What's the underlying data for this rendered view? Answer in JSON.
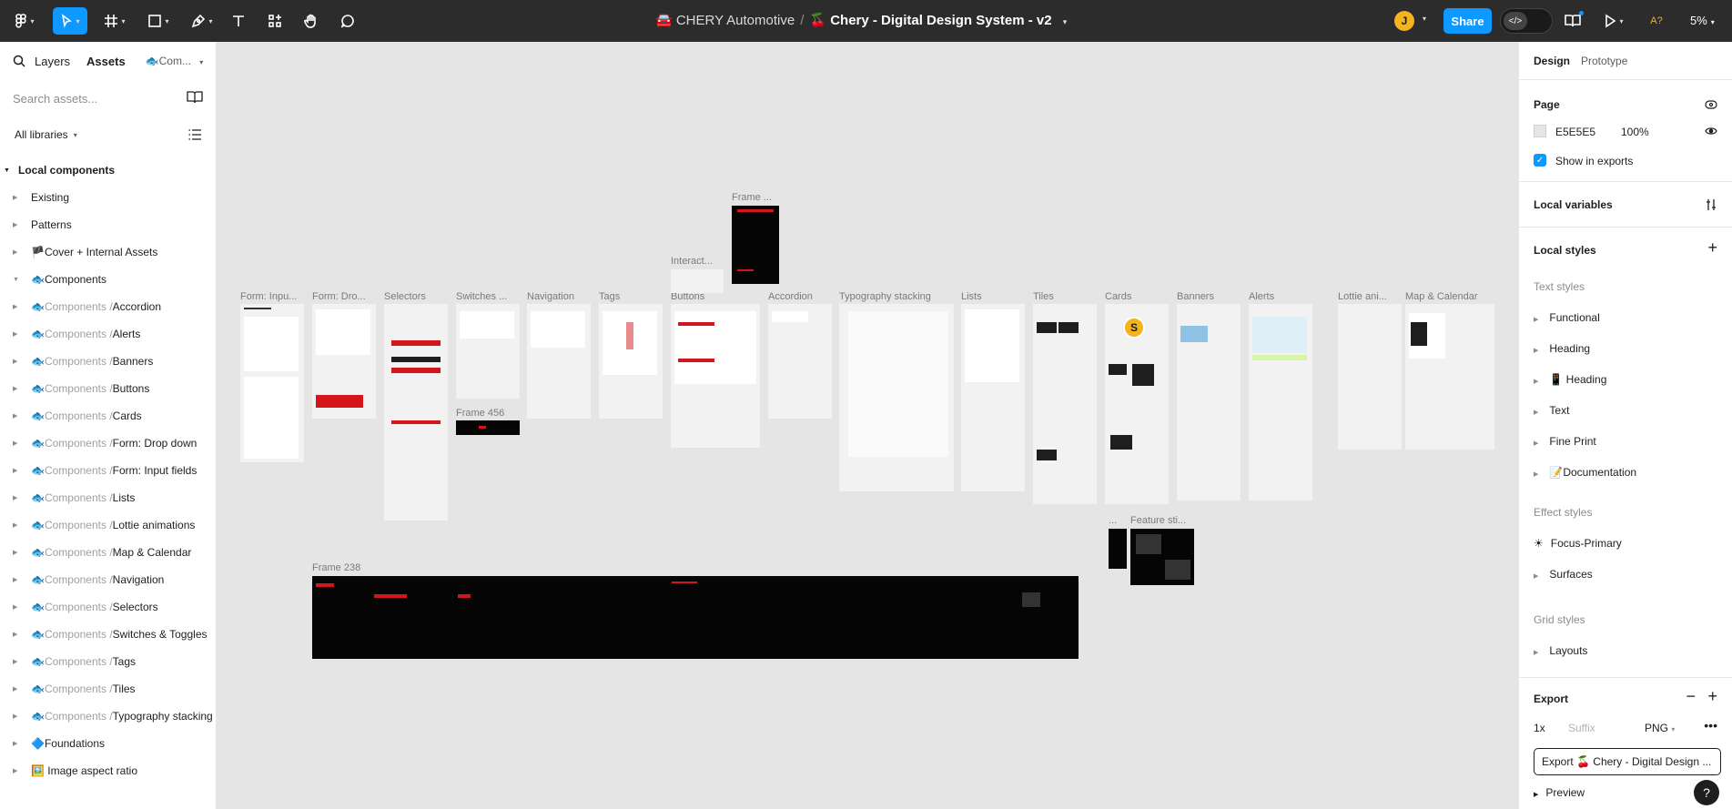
{
  "toolbar": {
    "title_team": "🚘 CHERY Automotive",
    "title_sep": "/",
    "title_file": "🍒 Chery - Digital Design System - v2",
    "avatar_initial": "J",
    "share_label": "Share",
    "zoom": "5%",
    "accessibility_label": "A?"
  },
  "left_panel": {
    "tabs": [
      "Layers",
      "Assets"
    ],
    "library_dropdown": "🐟Com...",
    "search_placeholder": "Search assets...",
    "libraries_dropdown": "All libraries",
    "section_title": "Local components",
    "items": [
      {
        "prefix": "",
        "label": "Existing"
      },
      {
        "prefix": "",
        "label": "Patterns"
      },
      {
        "prefix": "",
        "label": "🏴Cover + Internal Assets"
      },
      {
        "prefix": "",
        "label": "🐟Components"
      },
      {
        "prefix": "🐟Components / ",
        "label": "Accordion"
      },
      {
        "prefix": "🐟Components / ",
        "label": "Alerts"
      },
      {
        "prefix": "🐟Components / ",
        "label": "Banners"
      },
      {
        "prefix": "🐟Components / ",
        "label": "Buttons"
      },
      {
        "prefix": "🐟Components / ",
        "label": "Cards"
      },
      {
        "prefix": "🐟Components / ",
        "label": "Form: Drop down"
      },
      {
        "prefix": "🐟Components / ",
        "label": "Form: Input fields"
      },
      {
        "prefix": "🐟Components / ",
        "label": "Lists"
      },
      {
        "prefix": "🐟Components / ",
        "label": "Lottie animations"
      },
      {
        "prefix": "🐟Components / ",
        "label": "Map & Calendar"
      },
      {
        "prefix": "🐟Components / ",
        "label": "Navigation"
      },
      {
        "prefix": "🐟Components / ",
        "label": "Selectors"
      },
      {
        "prefix": "🐟Components / ",
        "label": "Switches & Toggles"
      },
      {
        "prefix": "🐟Components / ",
        "label": "Tags"
      },
      {
        "prefix": "🐟Components / ",
        "label": "Tiles"
      },
      {
        "prefix": "🐟Components / ",
        "label": "Typography stacking"
      },
      {
        "prefix": "",
        "label": "🔷Foundations"
      },
      {
        "prefix": "",
        "label": "🖼️ Image aspect ratio"
      }
    ]
  },
  "right_panel": {
    "tabs": [
      "Design",
      "Prototype"
    ],
    "page_heading": "Page",
    "page_color": "E5E5E5",
    "page_opacity": "100%",
    "show_in_exports": "Show in exports",
    "local_variables": "Local variables",
    "local_styles": "Local styles",
    "text_styles_heading": "Text styles",
    "text_styles": [
      "Functional",
      "Heading",
      "📱 Heading",
      "Text",
      "Fine Print",
      "📝Documentation"
    ],
    "effect_styles_heading": "Effect styles",
    "effect_styles": [
      "Focus-Primary",
      "Surfaces"
    ],
    "grid_styles_heading": "Grid styles",
    "grid_styles": [
      "Layouts"
    ],
    "export_heading": "Export",
    "export_scale": "1x",
    "export_suffix_placeholder": "Suffix",
    "export_format": "PNG",
    "export_button": "Export 🍒 Chery - Digital Design ...",
    "preview": "Preview",
    "help": "?"
  },
  "canvas": {
    "frame_labels": {
      "form_input": "Form: Inpu...",
      "form_drop": "Form: Dro...",
      "selectors": "Selectors",
      "switches": "Switches ...",
      "navigation": "Navigation",
      "tags": "Tags",
      "buttons": "Buttons",
      "accordion": "Accordion",
      "typography": "Typography stacking",
      "lists": "Lists",
      "tiles": "Tiles",
      "cards": "Cards",
      "banners": "Banners",
      "alerts": "Alerts",
      "lottie": "Lottie ani...",
      "map_calendar": "Map & Calendar",
      "frame_top": "Frame ...",
      "interact": "Interact...",
      "frame_456": "Frame 456",
      "frame_238": "Frame 238",
      "feature": "Feature sti...",
      "ellipsis": "..."
    },
    "cursor_initial": "S"
  }
}
